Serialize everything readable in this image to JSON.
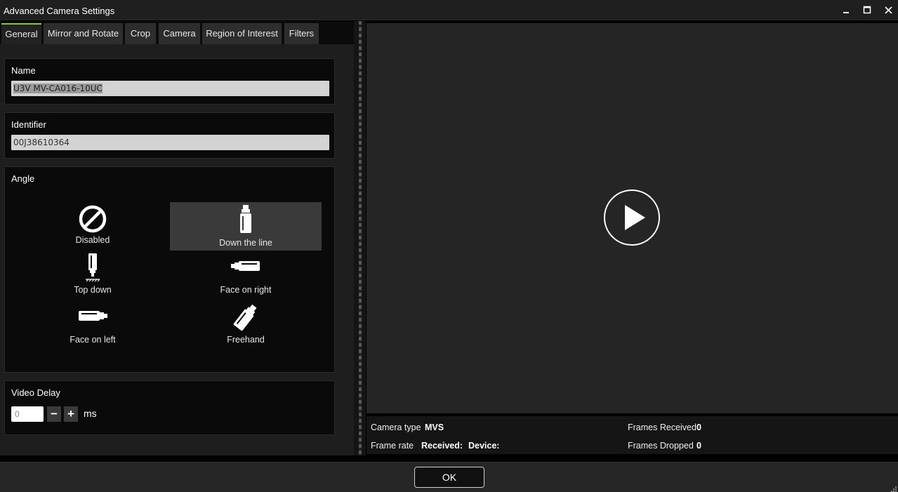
{
  "window": {
    "title": "Advanced Camera Settings",
    "minimize_glyph": "▁",
    "maximize_glyph": "□",
    "close_glyph": "✕"
  },
  "tabs": [
    {
      "label": "General",
      "active": true
    },
    {
      "label": "Mirror and Rotate",
      "active": false
    },
    {
      "label": "Crop",
      "active": false
    },
    {
      "label": "Camera",
      "active": false
    },
    {
      "label": "Region of Interest",
      "active": false
    },
    {
      "label": "Filters",
      "active": false
    }
  ],
  "general": {
    "name_label": "Name",
    "name_value": "U3V MV-CA016-10UC",
    "identifier_label": "Identifier",
    "identifier_value": "00J38610364",
    "angle_label": "Angle",
    "angle_options": [
      {
        "label": "Disabled",
        "icon": "disabled-icon",
        "selected": false
      },
      {
        "label": "Down the line",
        "icon": "camera-down-the-line-icon",
        "selected": true
      },
      {
        "label": "Top down",
        "icon": "camera-top-down-icon",
        "selected": false
      },
      {
        "label": "Face on right",
        "icon": "camera-face-on-right-icon",
        "selected": false
      },
      {
        "label": "Face on left",
        "icon": "camera-face-on-left-icon",
        "selected": false
      },
      {
        "label": "Freehand",
        "icon": "camera-freehand-icon",
        "selected": false
      }
    ],
    "video_delay_label": "Video Delay",
    "video_delay_value": "0",
    "video_delay_unit": "ms",
    "decrement_glyph": "−",
    "increment_glyph": "+"
  },
  "info": {
    "camera_type_label": "Camera type",
    "camera_type_value": "MVS",
    "frame_rate_label": "Frame rate",
    "received_label": "Received:",
    "device_label": "Device:",
    "frames_received_label": "Frames Received",
    "frames_received_value": "0",
    "frames_dropped_label": "Frames Dropped",
    "frames_dropped_value": "0"
  },
  "footer": {
    "ok_label": "OK"
  },
  "colors": {
    "accent": "#8bc34a",
    "background": "#000000",
    "panel": "#0a0a0a",
    "selected_option": "#3a3a3a"
  }
}
